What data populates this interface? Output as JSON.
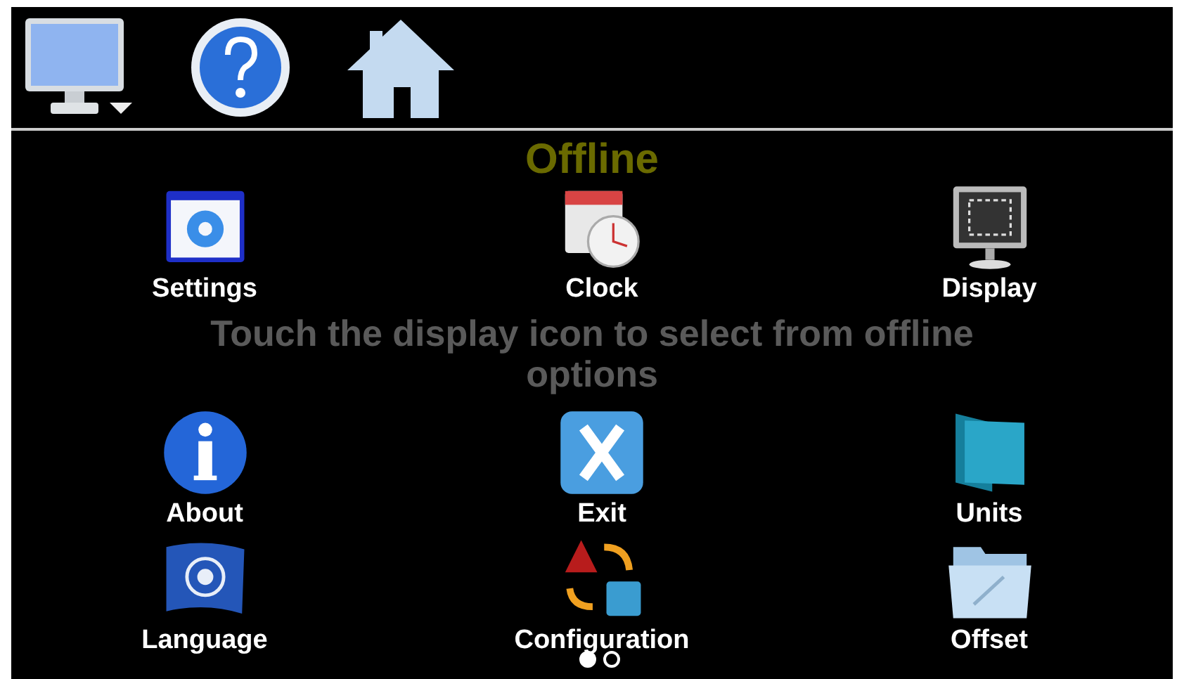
{
  "overlay": {
    "title": "Offline",
    "message": "Touch the display icon to select from offline options"
  },
  "menu_items": [
    {
      "label": "Settings"
    },
    {
      "label": "Clock"
    },
    {
      "label": "Display"
    },
    {
      "label": "About"
    },
    {
      "label": "Exit"
    },
    {
      "label": "Units"
    },
    {
      "label": "Language"
    },
    {
      "label": "Configuration"
    },
    {
      "label": "Offset"
    }
  ],
  "page_indicator": [
    {
      "selected": true
    },
    {
      "selected": false
    }
  ]
}
